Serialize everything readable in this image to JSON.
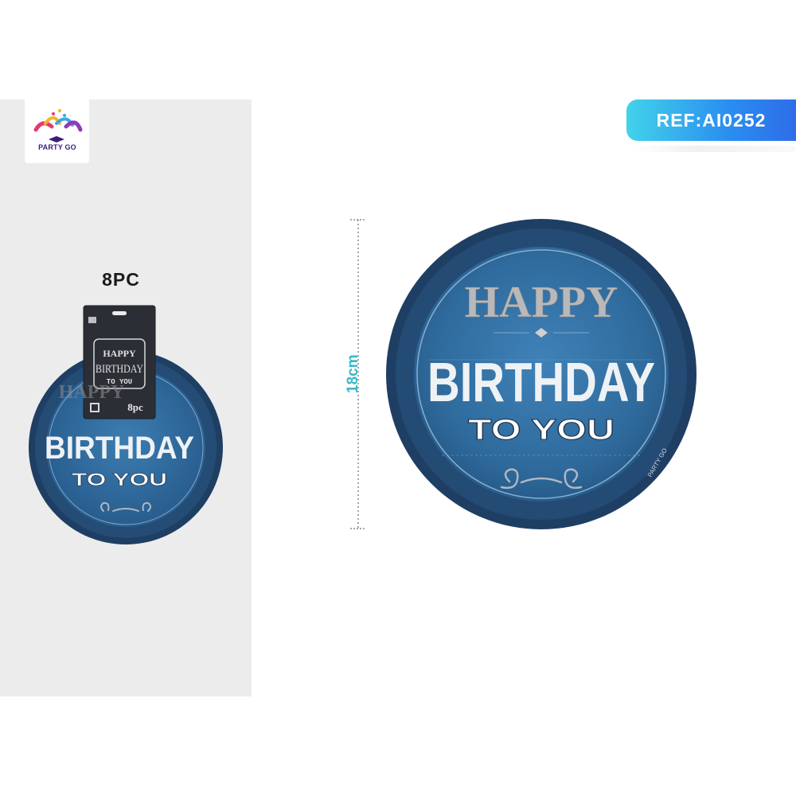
{
  "brand": {
    "name": "PARTY GO"
  },
  "pack": {
    "count_label": "8PC"
  },
  "reference": {
    "label": "REF:AI0252"
  },
  "dimension": {
    "label": "18cm"
  },
  "plate": {
    "line1": "HAPPY",
    "line2": "BIRTHDAY",
    "line3": "TO YOU",
    "rim_text": "PARTY GO"
  },
  "package_card": {
    "line1": "HAPPY",
    "line2": "BIRTHDAY",
    "line3": "TO YOU",
    "count": "8pc"
  },
  "colors": {
    "plate_dark": "#1e3f63",
    "plate_mid": "#2f6a9c",
    "plate_light": "#3c7db1",
    "happy_silver": "#b9b9b9",
    "ref_gradient_start": "#42d3ea",
    "ref_gradient_end": "#2d6de8",
    "dimension": "#39b8c8"
  }
}
